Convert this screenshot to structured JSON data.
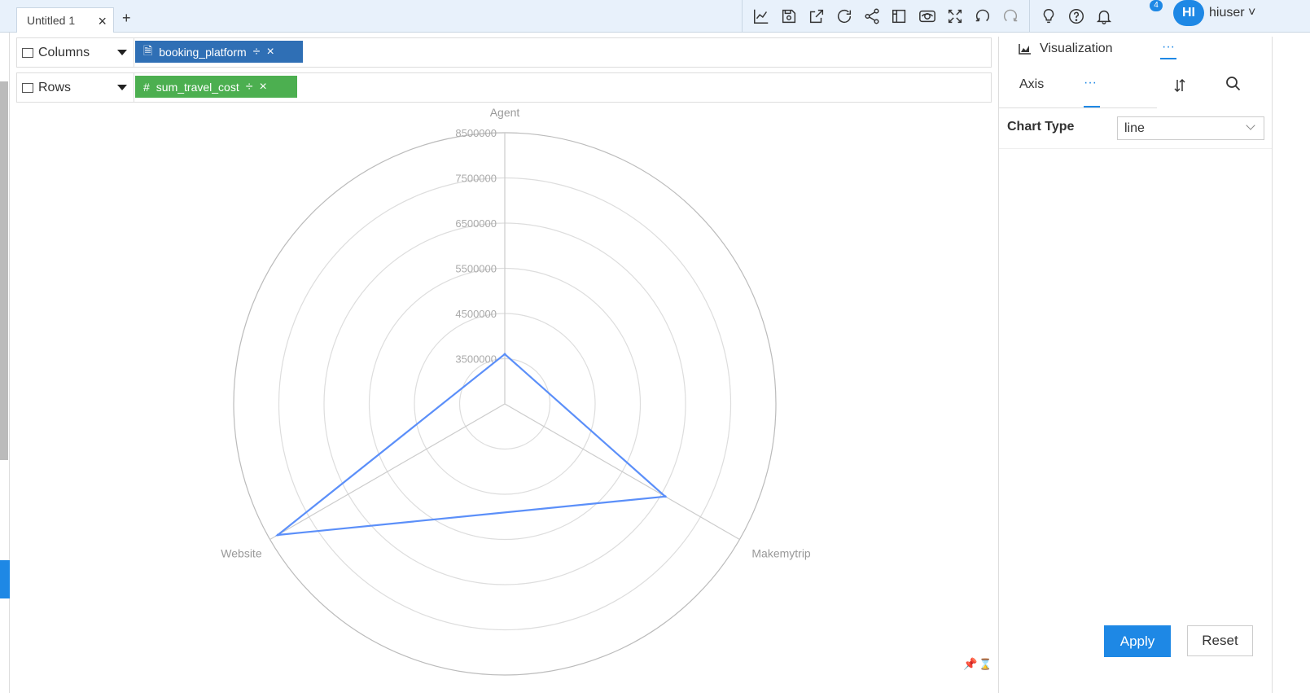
{
  "tabs": {
    "active_label": "Untitled 1",
    "add_label": "+"
  },
  "toolbar": {
    "icons": [
      "line-chart-icon",
      "save-icon",
      "export-icon",
      "refresh-icon",
      "share-icon",
      "layout-icon",
      "preview-icon",
      "fullscreen-icon",
      "undo-icon",
      "redo-icon",
      "bulb-icon",
      "help-icon",
      "bell-icon"
    ],
    "notification_count": "4",
    "avatar_initials": "HI",
    "username": "hiuser"
  },
  "shelves": {
    "columns": {
      "label": "Columns",
      "field": "booking_platform"
    },
    "rows": {
      "label": "Rows",
      "field": "sum_travel_cost"
    }
  },
  "right_panel": {
    "visualization_label": "Visualization",
    "more_label": "···",
    "axis_label": "Axis",
    "chart_type_label": "Chart Type",
    "chart_type_value": "line",
    "apply_label": "Apply",
    "reset_label": "Reset"
  },
  "chart_data": {
    "type": "radar",
    "categories": [
      "Agent",
      "Makemytrip",
      "Website"
    ],
    "values": [
      3600000,
      6600000,
      8300000
    ],
    "tick_labels": [
      "3500000",
      "4500000",
      "5500000",
      "6500000",
      "7500000",
      "8500000"
    ],
    "rlim": [
      2500000,
      8500000
    ],
    "line_color": "#5b8ff9"
  }
}
